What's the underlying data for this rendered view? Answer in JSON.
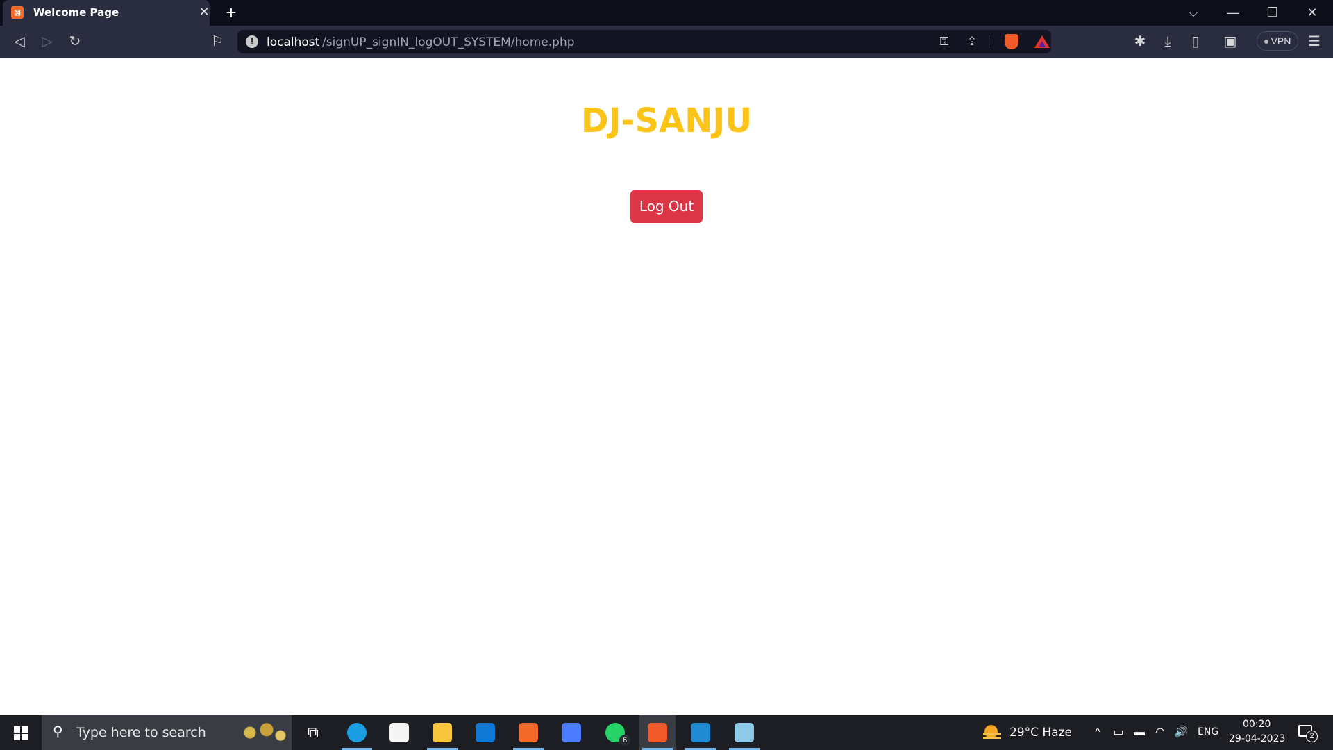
{
  "browser": {
    "tab": {
      "title": "Welcome Page",
      "favicon": "xampp-icon",
      "close_glyph": "✕"
    },
    "new_tab_glyph": "+",
    "window_controls": {
      "tab_search_glyph": "⌵",
      "minimize_glyph": "—",
      "restore_glyph": "❐",
      "close_glyph": "✕"
    },
    "toolbar": {
      "back_glyph": "◁",
      "forward_glyph": "▷",
      "reload_glyph": "↻",
      "bookmark_glyph": "⚐",
      "url_host": "localhost",
      "url_path": "/signUP_signIN_logOUT_SYSTEM/home.php",
      "site_info_glyph": "!",
      "key_glyph": "⚿",
      "share_glyph": "⇪",
      "extensions_glyph": "✱",
      "download_glyph": "⤓",
      "sidebar_glyph": "▯",
      "wallet_glyph": "▣",
      "vpn_label": "VPN",
      "menu_glyph": "☰"
    }
  },
  "page": {
    "heading": "DJ-SANJU",
    "logout_label": "Log Out",
    "heading_color": "#fcc419",
    "button_color": "#dc3545"
  },
  "taskbar": {
    "search_placeholder": "Type here to search",
    "search_glyph": "⚲",
    "apps": [
      {
        "name": "task-view",
        "color": "#2b2d33"
      },
      {
        "name": "edge",
        "color": "#1b9de2"
      },
      {
        "name": "microsoft-store",
        "color": "#f4f4f4"
      },
      {
        "name": "file-explorer",
        "color": "#f8c63d"
      },
      {
        "name": "mail",
        "color": "#0f78d4"
      },
      {
        "name": "xampp",
        "color": "#f26b2a"
      },
      {
        "name": "power-automate",
        "color": "#4e7cff"
      },
      {
        "name": "whatsapp",
        "color": "#25d366"
      },
      {
        "name": "brave",
        "color": "#f25a29"
      },
      {
        "name": "vscode",
        "color": "#1f8ad2"
      },
      {
        "name": "notepad",
        "color": "#8fcbe8"
      }
    ],
    "whatsapp_badge": "6",
    "task_view_glyph": "⧉",
    "weather": "29°C  Haze",
    "language": "ENG",
    "time": "00:20",
    "date": "29-04-2023",
    "notification_count": "2",
    "tray_glyphs": {
      "chevron": "^",
      "meet": "▭",
      "battery": "▬",
      "wifi": "◠",
      "volume": "🔊"
    }
  }
}
